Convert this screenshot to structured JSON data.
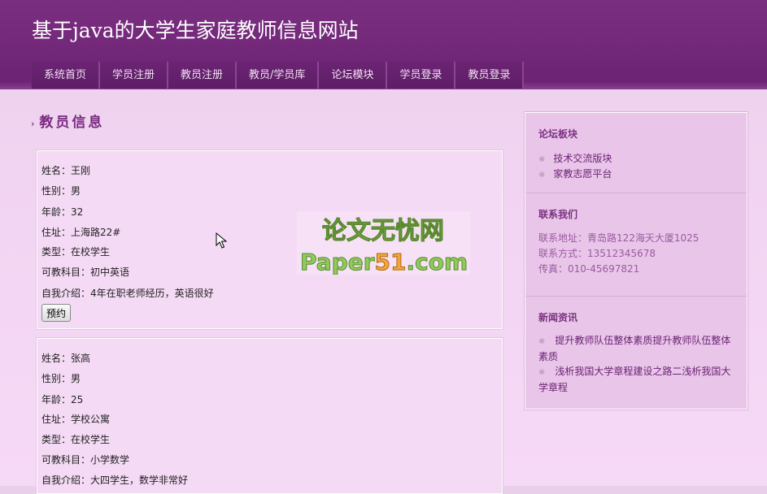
{
  "header": {
    "title": "基于java的大学生家庭教师信息网站",
    "nav": [
      "系统首页",
      "学员注册",
      "教员注册",
      "教员/学员库",
      "论坛模块",
      "学员登录",
      "教员登录"
    ]
  },
  "main": {
    "section_title": "教员信息",
    "teachers": [
      {
        "name": "姓名：王刚",
        "gender": "性别：男",
        "age": "年龄：32",
        "address": "住址：上海路22#",
        "type": "类型：在校学生",
        "subject": "可教科目：初中英语",
        "intro": "自我介绍：4年在职老师经历，英语很好",
        "button": "预约"
      },
      {
        "name": "姓名：张高",
        "gender": "性别：男",
        "age": "年龄：25",
        "address": "住址：学校公寓",
        "type": "类型：在校学生",
        "subject": "可教科目：小学数学",
        "intro": "自我介绍：大四学生，数学非常好"
      }
    ]
  },
  "watermark": {
    "line1": "论文无忧网",
    "line2a": "Paper",
    "line2b": "51",
    "line2c": ".com"
  },
  "sidebar": {
    "forum": {
      "title": "论坛板块",
      "links": [
        "技术交流版块",
        "家教志愿平台"
      ]
    },
    "contact": {
      "title": "联系我们",
      "address": "联系地址：青岛路122海天大厦1025",
      "phone": "联系方式：13512345678",
      "fax": "传真：010-45697821"
    },
    "news": {
      "title": "新闻资讯",
      "items": [
        "提升教师队伍整体素质提升教师队伍整体素质",
        "浅析我国大学章程建设之路二浅析我国大学章程"
      ]
    }
  },
  "colors": {
    "header_bg": "#73287a",
    "accent": "#7a2b80",
    "page_bg": "#f3d7f3"
  }
}
